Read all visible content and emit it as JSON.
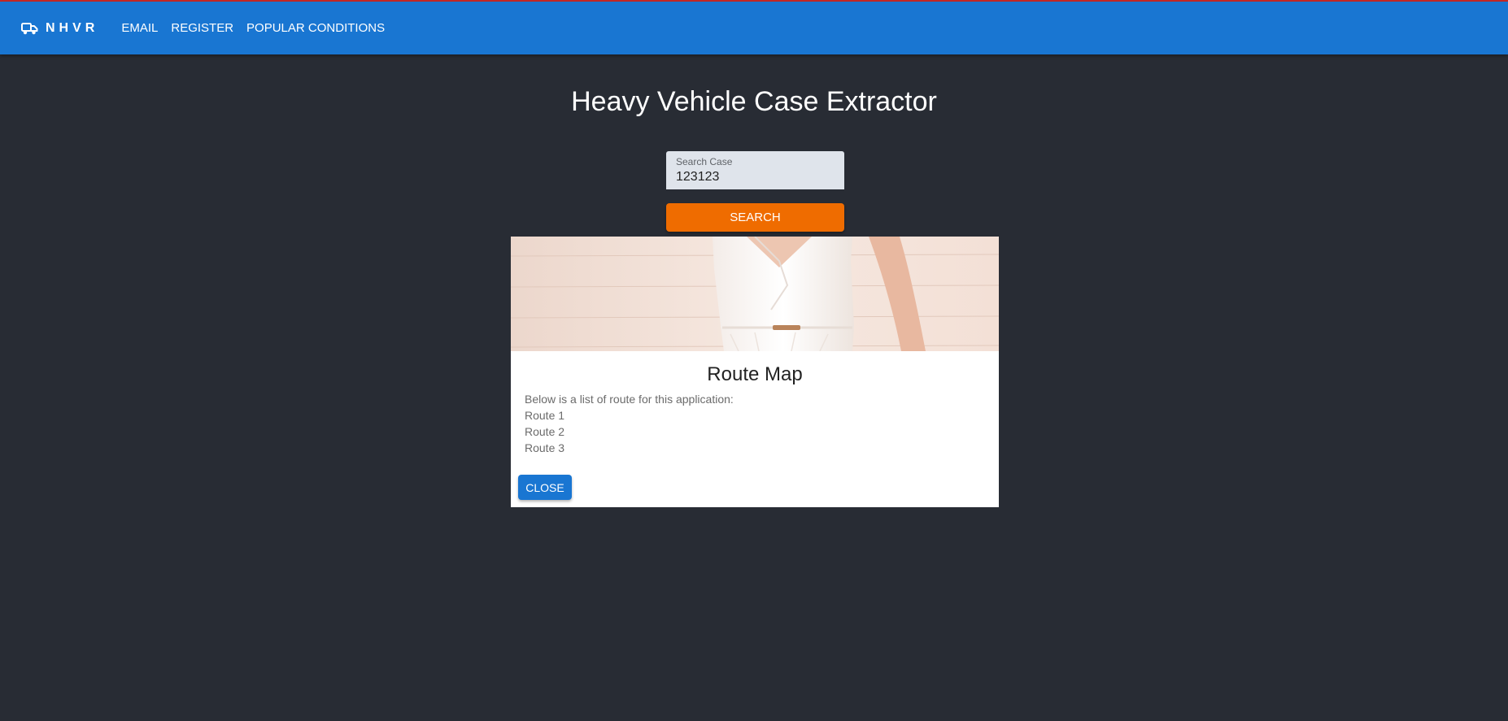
{
  "header": {
    "brand_icon": "truck-icon",
    "brand": "NHVR",
    "nav": [
      {
        "label": "EMAIL"
      },
      {
        "label": "REGISTER"
      },
      {
        "label": "POPULAR CONDITIONS"
      }
    ],
    "bar_color": "#1976d2",
    "top_accent_color": "#c62828"
  },
  "main": {
    "title": "Heavy Vehicle Case Extractor",
    "search": {
      "label": "Search Case",
      "value": "123123"
    },
    "search_button_label": "SEARCH",
    "search_button_color": "#ef6c00"
  },
  "dialog": {
    "title": "Route Map",
    "intro": "Below is a list of route for this application:",
    "routes": [
      "Route 1",
      "Route 2",
      "Route 3"
    ],
    "close_label": "CLOSE",
    "close_button_color": "#1976d2"
  }
}
